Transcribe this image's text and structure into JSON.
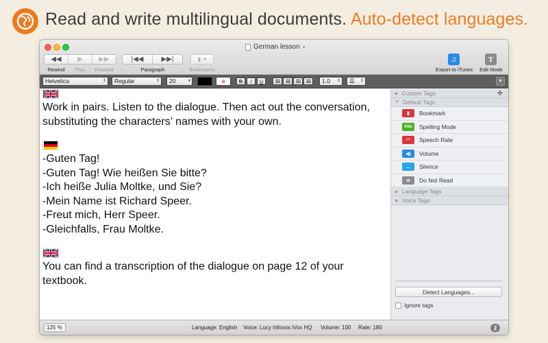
{
  "banner": {
    "headline": "Read and write multilingual documents.",
    "headline_accent": "Auto-detect languages.",
    "colors": {
      "accent": "#ec7c22",
      "text": "#3a3a3a"
    }
  },
  "window": {
    "title": "German lesson",
    "toolbar": {
      "rewind": "Rewind",
      "play": "Play",
      "forward": "Forward",
      "paragraph": "Paragraph",
      "bookmarks": "Bookmarks",
      "export": "Export to iTunes",
      "edit_mode": "Edit Mode"
    },
    "format": {
      "font": "Helvetica",
      "style": "Regular",
      "size": "20",
      "line_spacing": "1.0",
      "bold": "B",
      "italic": "I",
      "underline": "U",
      "highlight": "a"
    }
  },
  "document": {
    "para1": "Work in pairs. Listen to the dialogue. Then act out the conversation, substituting the characters’ names with your own.",
    "lines": [
      "-Guten Tag!",
      "-Guten Tag! Wie heißen Sie bitte?",
      "-Ich heiße Julia Moltke, und Sie?",
      "-Mein Name ist Richard Speer.",
      "-Freut mich, Herr Speer.",
      "-Gleichfalls, Frau Moltke."
    ],
    "para3": "You can find a transcription of the dialogue on page 12 of your textbook."
  },
  "sidebar": {
    "custom_tags": "Custom Tags",
    "default_tags": "Default Tags",
    "tags": [
      {
        "label": "Bookmark",
        "icon": "bookmark-icon",
        "color": "#d9363e"
      },
      {
        "label": "Spelling Mode",
        "icon": "abc-icon",
        "color": "#4caf29",
        "icon_text": "Abc"
      },
      {
        "label": "Speech Rate",
        "icon": "speedometer-icon",
        "color": "#d9363e"
      },
      {
        "label": "Volume",
        "icon": "speaker-icon",
        "color": "#2a8ae6"
      },
      {
        "label": "Silence",
        "icon": "ellipsis-icon",
        "color": "#28a5e6",
        "icon_text": "..."
      },
      {
        "label": "Do Not Read",
        "icon": "no-read-icon",
        "color": "#8c8c8c"
      }
    ],
    "language_tags": "Language Tags",
    "voice_tags": "Voice Tags",
    "detect_button": "Detect Languages...",
    "ignore_tags": "Ignore tags"
  },
  "status": {
    "zoom": "125 %",
    "language": "Language: English",
    "voice": "Voice: Lucy Infovox iVox HQ",
    "volume": "Volume: 100",
    "rate": "Rate: 180",
    "count": "2"
  }
}
